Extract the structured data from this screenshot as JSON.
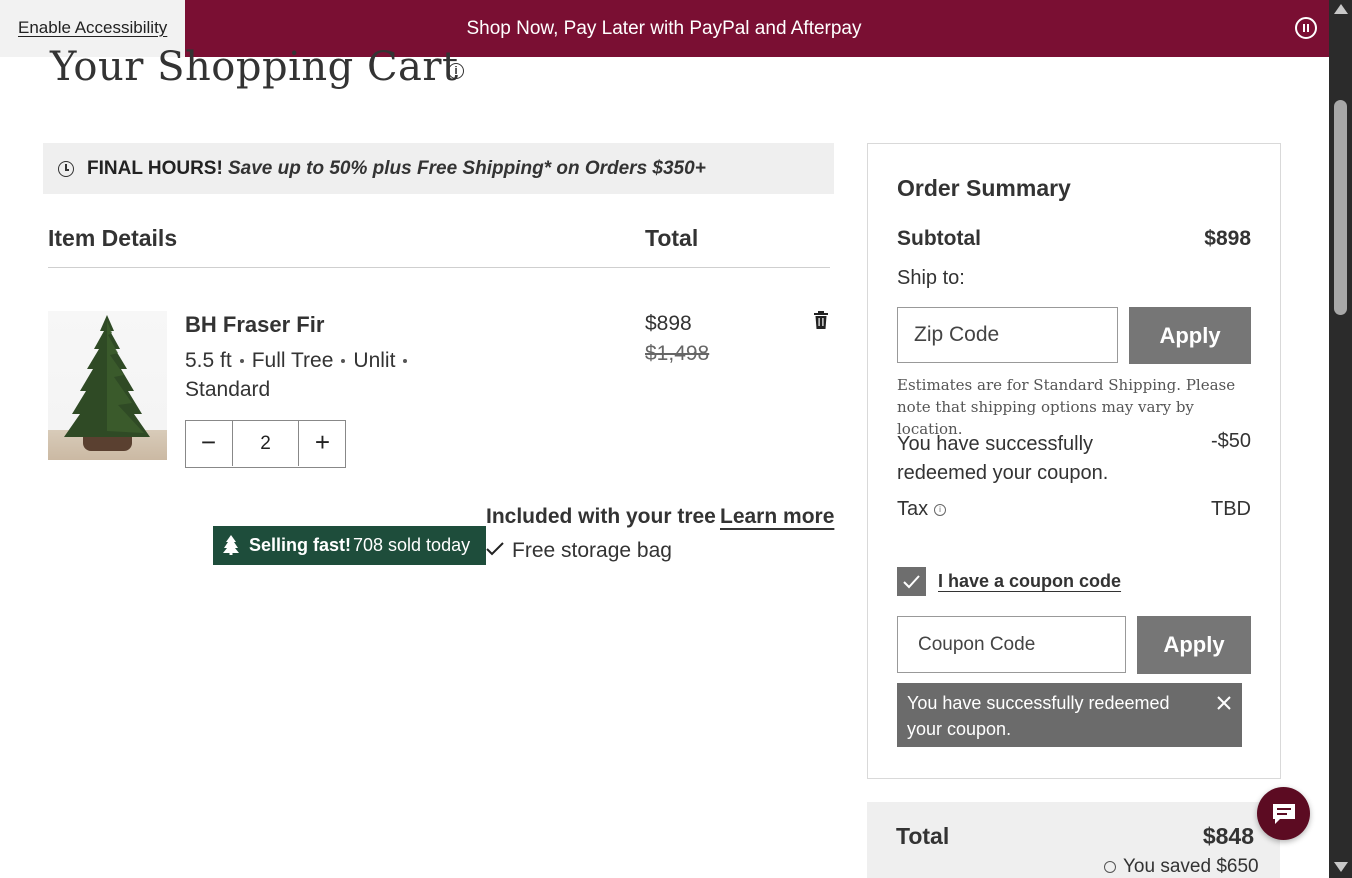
{
  "topbar": {
    "accessibility_link": "Enable Accessibility",
    "promo_text": "Shop Now, Pay Later with PayPal and Afterpay",
    "promo_bg": "#7a0f33"
  },
  "page": {
    "title": "Your Shopping Cart",
    "info_icon": "i"
  },
  "deal": {
    "icon": "clock-icon",
    "bold": "FINAL HOURS!",
    "italic": "Save up to 50% plus Free Shipping* on Orders $350+"
  },
  "table": {
    "col_item": "Item Details",
    "col_total": "Total"
  },
  "item": {
    "name": "BH Fraser Fir",
    "options": [
      "5.5 ft",
      "Full Tree",
      "Unlit",
      "Standard"
    ],
    "quantity": "2",
    "qty_minus": "−",
    "qty_plus": "+",
    "price": "$898",
    "original_price": "$1,498",
    "selling_bold": "Selling fast!",
    "selling_rest": "708 sold today",
    "included_title": "Included with your tree",
    "learn_more": "Learn more",
    "included_item": "Free storage bag",
    "badge_color": "#1e4d3b"
  },
  "summary": {
    "title": "Order Summary",
    "subtotal_label": "Subtotal",
    "subtotal_value": "$898",
    "ship_to": "Ship to:",
    "zip_placeholder": "Zip Code",
    "apply": "Apply",
    "ship_note": "Estimates are for Standard Shipping. Please note that shipping options may vary by location.",
    "coupon_message": "You have successfully redeemed your coupon.",
    "coupon_amount": "-$50",
    "tax_label": "Tax",
    "tax_value": "TBD",
    "coupon_checkbox_label": "I have a coupon code",
    "coupon_checked": true,
    "coupon_placeholder": "Coupon Code",
    "coupon_apply": "Apply",
    "toast_text": "You have successfully redeemed your coupon.",
    "button_color": "#767676"
  },
  "total": {
    "label": "Total",
    "value": "$848",
    "saved": "You saved $650"
  },
  "chat": {
    "icon": "chat-icon",
    "color": "#5c0b22"
  }
}
